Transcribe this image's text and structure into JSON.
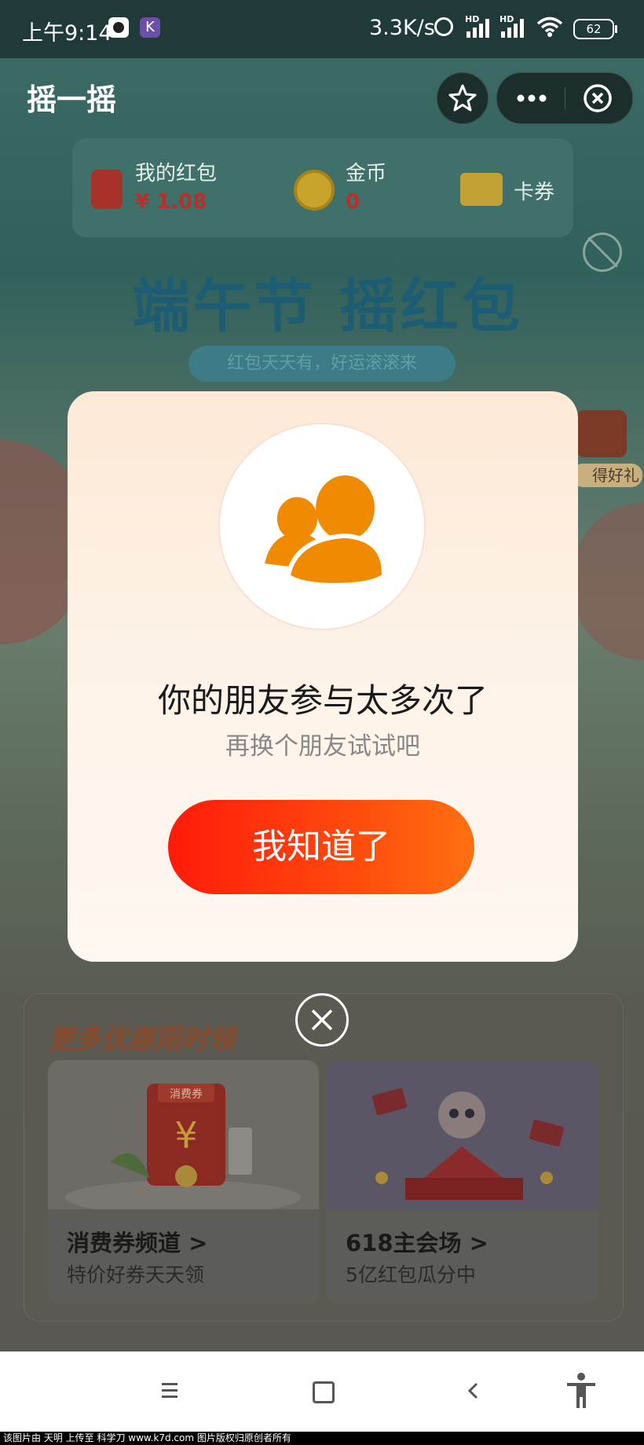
{
  "status_bar": {
    "time": "上午9:14",
    "app_badge": "K",
    "network_speed": "3.3K/s",
    "hd1": "HD",
    "hd2": "HD",
    "battery": "62"
  },
  "nav": {
    "title": "摇一摇",
    "icons": [
      "star-icon",
      "more-icon",
      "close-circle-icon"
    ]
  },
  "wallet": {
    "red_packet_label": "我的红包",
    "red_packet_value": "¥ 1.08",
    "coin_label": "金币",
    "coin_value": "0",
    "card_label": "卡券"
  },
  "banner": {
    "title": "端午节 摇红包",
    "subtitle": "红包天天有，好运滚滚来",
    "side_gift_label": "得好礼"
  },
  "modal": {
    "title": "你的朋友参与太多次了",
    "subtitle": "再换个朋友试试吧",
    "button": "我知道了",
    "accent": "#f08a00"
  },
  "more": {
    "title": "更多优惠限时领",
    "cards": [
      {
        "name": "消费券频道 >",
        "desc": "特价好券天天领",
        "tag": "消费券"
      },
      {
        "name": "618主会场 >",
        "desc": "5亿红包瓜分中"
      }
    ]
  },
  "footer": {
    "text": "该图片由 天明 上传至 科学刀 www.k7d.com 图片版权归原创者所有"
  },
  "colors": {
    "button_start": "#ff1b0a",
    "button_end": "#ff7010",
    "red_value": "#b9302a"
  }
}
